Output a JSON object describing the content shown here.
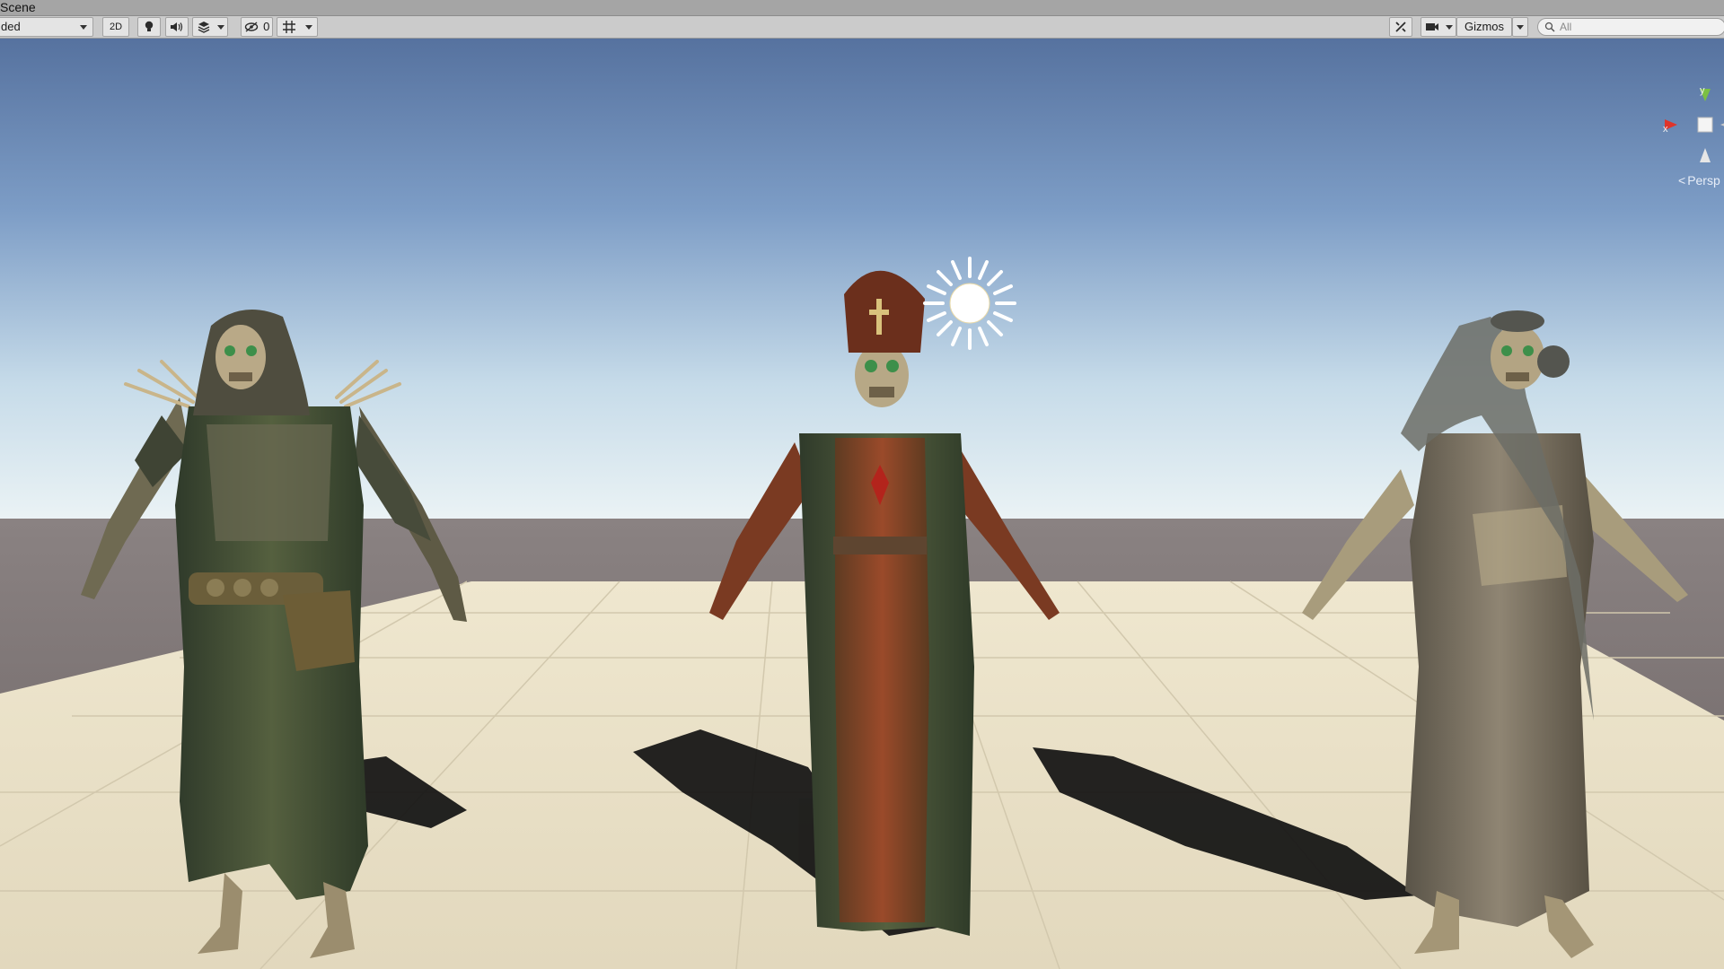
{
  "window": {
    "tab_title": "Scene"
  },
  "toolbar": {
    "shading_mode": "ded",
    "mode_2d": "2D",
    "hidden_objects_count": "0",
    "gizmos_label": "Gizmos",
    "search_placeholder": "All"
  },
  "viewport": {
    "projection_label": "Persp",
    "axis_x": "x",
    "axis_y": "y",
    "characters": [
      {
        "name": "hooded-witch-skeleton"
      },
      {
        "name": "bishop-skeleton"
      },
      {
        "name": "bride-skeleton"
      }
    ],
    "colors": {
      "sky_top": "#5a77a3",
      "sky_horizon": "#e8f2f7",
      "ground_far": "#7b7272",
      "plane": "#e8dfc6",
      "grid_line": "#cfc6ad"
    },
    "icons": [
      "sun-light-icon"
    ]
  }
}
